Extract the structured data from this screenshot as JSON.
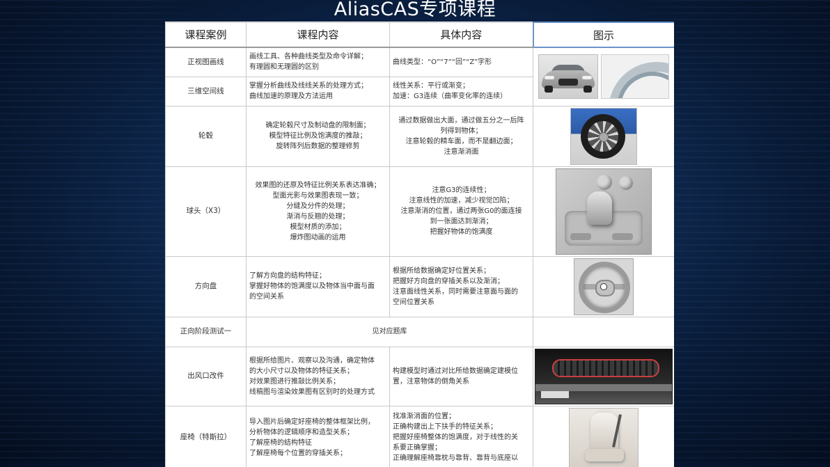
{
  "title": "AliasCAS专项课程",
  "headers": [
    "课程案例",
    "课程内容",
    "具体内容",
    "图示"
  ],
  "rows": [
    {
      "case": "正视图画线",
      "content": [
        "画线工具、各种曲线类型及命令详解；",
        "有理圆和无理圆的区别"
      ],
      "detail": [
        "曲线类型：“O”“7”“回”“Z”字形"
      ],
      "image": "car-front-view-and-fender-arc-image"
    },
    {
      "case": "三维空间线",
      "content": [
        "掌握分析曲线及线线关系的处理方式；",
        "曲线加速的原理及方法运用"
      ],
      "detail": [
        "线性关系：平行或渐变；",
        "加速：G3连续（曲率变化率的连续）"
      ]
    },
    {
      "case": "轮毂",
      "content": [
        "确定轮毂尺寸及制动盘的限制面；",
        "模型特征比例及饱满度的推敲；",
        "旋转阵列后数据的整理修剪"
      ],
      "detail": [
        "通过数据做出大面，通过做五分之一后阵",
        "列得到物体；",
        "注意轮毂的精车面，而不是翻边面；",
        "注意渐消面"
      ],
      "image": "wheel-rim-image"
    },
    {
      "case": "球头（X3）",
      "content": [
        "效果图的还原及特征比例关系表达准确；",
        "型面光影与效果图表现一致；",
        "分缝及分件的处理；",
        "渐消与反翘的处理；",
        "模型材质的添加；",
        "爆炸图动画的运用"
      ],
      "detail": [
        "注意G3的连续性；",
        "注意线性的加速，减少视觉凹陷；",
        "注意渐消的位置，通过两张G0的面连接",
        "到一张面达到渐消；",
        "把握好物体的饱满度"
      ],
      "image": "gear-shifter-image"
    },
    {
      "case": "方向盘",
      "content": [
        "了解方向盘的结构特征；",
        "掌握好物体的饱满度以及物体当中面与面",
        "的空间关系"
      ],
      "detail": [
        "根据所给数据确定好位置关系；",
        "把握好方向盘的穿插关系以及渐消；",
        "注意面线性关系，同时需要注意面与面的",
        "空间位置关系"
      ],
      "image": "steering-wheel-image"
    },
    {
      "case": "正向阶段测试一",
      "merged": "见对应题库"
    },
    {
      "case": "出风口改件",
      "content": [
        "根据所给图片、观察以及沟通，确定物体",
        "的大小尺寸以及物体的特征关系；",
        "对效果图进行推敲比例关系；",
        "线稿图与渲染效果图有区别时的处理方式"
      ],
      "detail": [
        "构建模型时通过对比所给数据确定建模位",
        "置，注意物体的倒角关系"
      ],
      "image": "air-vent-image"
    },
    {
      "case": "座椅（特斯拉）",
      "content": [
        "导入图片后确定好座椅的整体框架比例，",
        "分析物体的逻辑顺序和造型关系；",
        "了解座椅的结构特征",
        "了解座椅每个位置的穿插关系；"
      ],
      "detail": [
        "找准渐消面的位置；",
        "正确构建出上下扶手的特征关系；",
        "把握好座椅整体的饱满度，对于线性的关",
        "系要正确掌握；",
        "正确理解座椅靠枕与靠背、靠背与底座以"
      ],
      "image": "car-seat-image"
    }
  ]
}
